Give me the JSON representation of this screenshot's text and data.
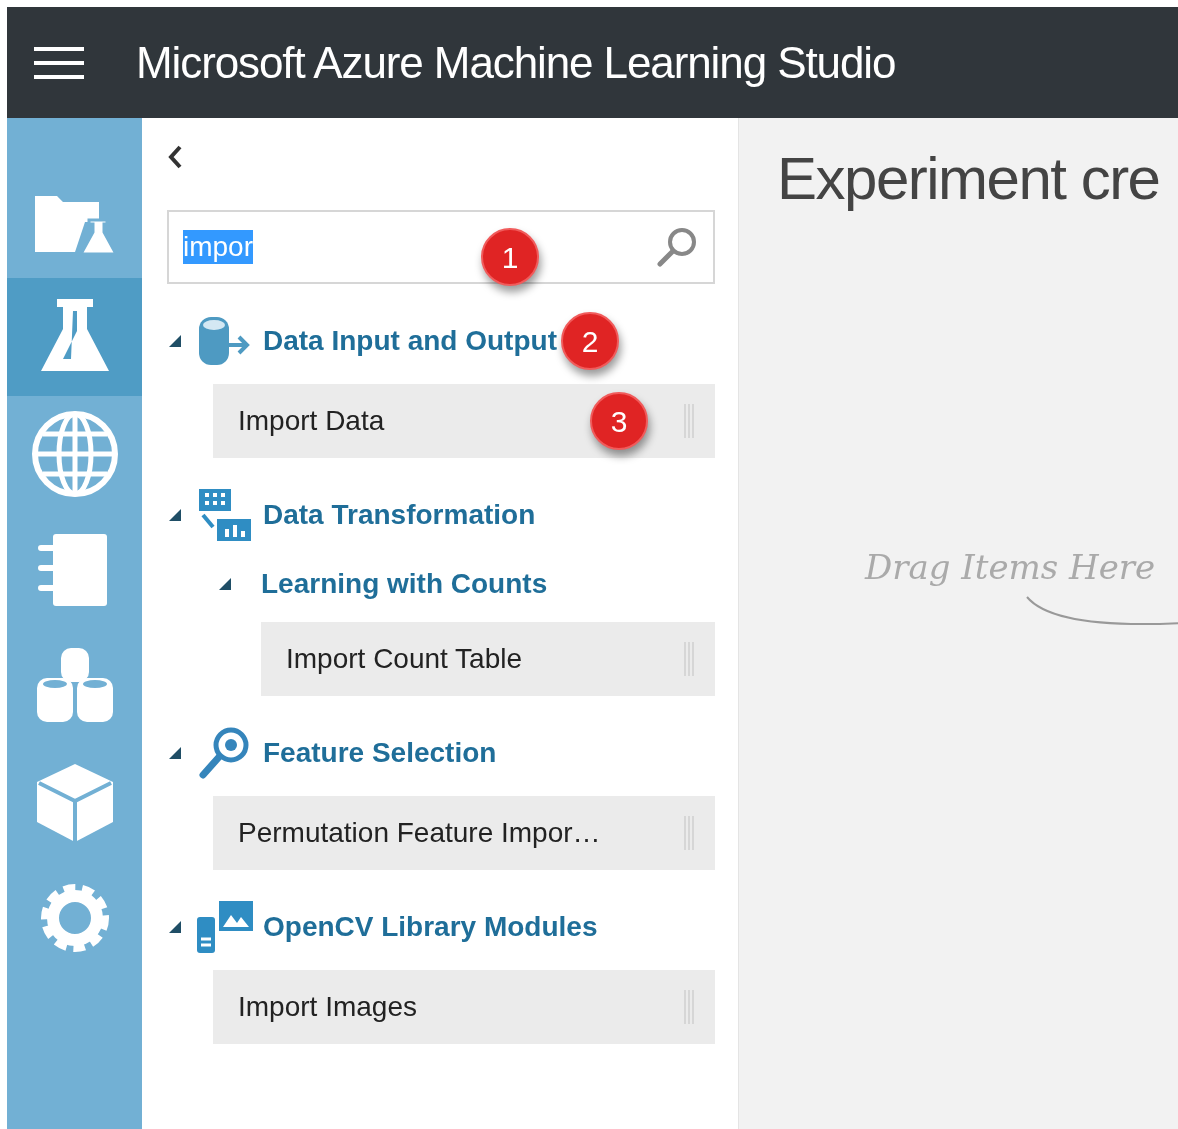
{
  "header": {
    "title": "Microsoft Azure Machine Learning Studio"
  },
  "rail": [
    {
      "kind": "projects",
      "selected": false
    },
    {
      "kind": "experiments",
      "selected": true
    },
    {
      "kind": "web-services",
      "selected": false
    },
    {
      "kind": "notebooks",
      "selected": false
    },
    {
      "kind": "datasets",
      "selected": false
    },
    {
      "kind": "trained-models",
      "selected": false
    },
    {
      "kind": "settings",
      "selected": false
    }
  ],
  "palette": {
    "search": {
      "value": "impor",
      "text_selected": true,
      "callout": "1"
    },
    "categories": [
      {
        "kind": "data-io",
        "title": "Data Input and Output",
        "expanded": true,
        "callout": "2",
        "children": [
          {
            "kind": "module",
            "label": "Import Data",
            "callout": "3"
          }
        ]
      },
      {
        "kind": "transform",
        "title": "Data Transformation",
        "expanded": true,
        "children": [
          {
            "kind": "group",
            "title": "Learning with Counts",
            "expanded": true,
            "children": [
              {
                "kind": "module",
                "label": "Import Count Table"
              }
            ]
          }
        ]
      },
      {
        "kind": "feature",
        "title": "Feature Selection",
        "expanded": true,
        "children": [
          {
            "kind": "module",
            "label": "Permutation Feature Impor…"
          }
        ]
      },
      {
        "kind": "opencv",
        "title": "OpenCV Library Modules",
        "expanded": true,
        "children": [
          {
            "kind": "module",
            "label": "Import Images"
          }
        ]
      }
    ]
  },
  "canvas": {
    "title": "Experiment cre",
    "hint": "Drag Items Here"
  }
}
